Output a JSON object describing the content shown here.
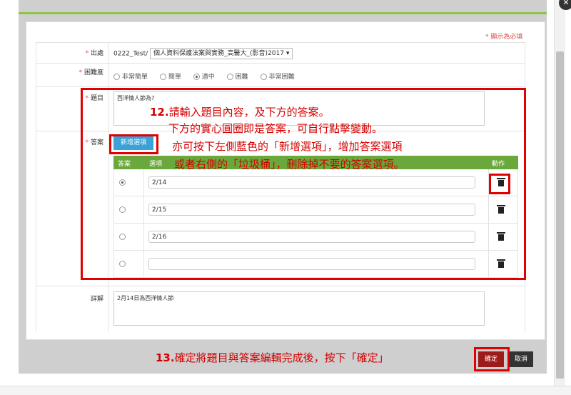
{
  "form": {
    "required_note": "* 顯示為必填",
    "source": {
      "label": "出處",
      "prefix": "0222_Test/",
      "select_value": "個人資料保護法案與實務_高醫大_(影音)2017"
    },
    "difficulty": {
      "label": "困難度",
      "options": [
        "非常簡單",
        "簡單",
        "適中",
        "困難",
        "非常困難"
      ],
      "selected_index": 2
    },
    "question": {
      "label": "題目",
      "value": "西洋情人節為?"
    },
    "answer": {
      "label": "答案",
      "add_button": "新增選項",
      "col_answer": "答案",
      "col_option": "選項",
      "col_action": "動作",
      "rows": [
        {
          "value": "2/14",
          "selected": true
        },
        {
          "value": "2/15",
          "selected": false
        },
        {
          "value": "2/16",
          "selected": false
        },
        {
          "value": "",
          "selected": false
        }
      ]
    },
    "explanation": {
      "label": "詳解",
      "value": "2月14日為西洋情人節"
    }
  },
  "annotations": {
    "step12_num": "12.",
    "step12_line1": "請輸入題目內容，及下方的答案。",
    "step12_line2": "下方的實心圓圈即是答案，可自行點擊變動。",
    "step12_line3": "亦可按下左側藍色的「新增選項」，增加答案選項",
    "step12_line4": "或者右側的「垃圾桶」，刪除掉不要的答案選項。",
    "step13_num": "13.",
    "step13_text": "確定將題目與答案編輯完成後，按下「確定」"
  },
  "footer": {
    "ok": "確定",
    "cancel": "取消"
  },
  "colors": {
    "accent_green": "#6aa83b",
    "button_blue": "#3aa2d8",
    "ok_red": "#9e1b1b",
    "annotation_red": "#e00000"
  }
}
